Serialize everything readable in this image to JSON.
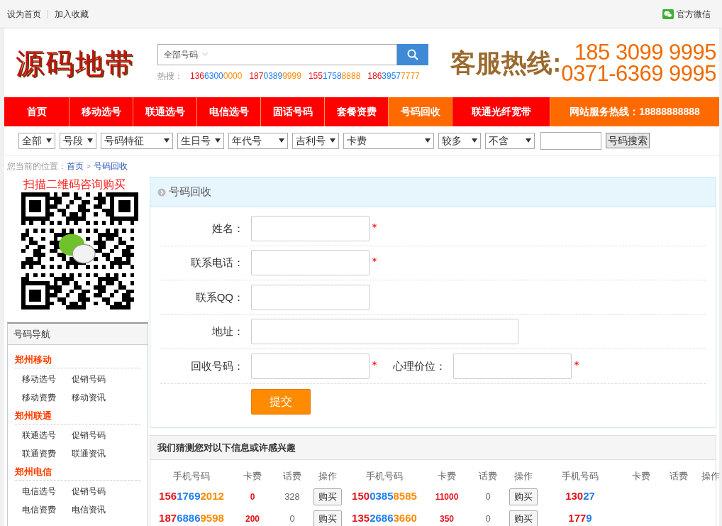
{
  "top_bar": {
    "links": [
      "设为首页",
      "加入收藏"
    ],
    "wechat_label": "官方微信"
  },
  "header": {
    "logo": "源码地带",
    "search": {
      "category": "全部号码",
      "hot_label": "热搜：",
      "hot_numbers": [
        [
          "136",
          "6300",
          "0000"
        ],
        [
          "187",
          "0389",
          "9999"
        ],
        [
          "155",
          "1758",
          "8888"
        ],
        [
          "186",
          "3957",
          "7777"
        ]
      ]
    },
    "hotline": {
      "label": "客服热线:",
      "lines": [
        "185 3099 9995",
        "0371-6369 9995"
      ]
    }
  },
  "nav": {
    "items": [
      {
        "label": "首页",
        "selected": false
      },
      {
        "label": "移动选号",
        "selected": false
      },
      {
        "label": "联通选号",
        "selected": false
      },
      {
        "label": "电信选号",
        "selected": false
      },
      {
        "label": "固话号码",
        "selected": false
      },
      {
        "label": "套餐资费",
        "selected": false
      },
      {
        "label": "号码回收",
        "selected": true
      },
      {
        "label": "联通光纤宽带",
        "selected": false
      }
    ],
    "service_hotline": "网站服务热线：18888888888"
  },
  "filters": {
    "selects": [
      "全部",
      "号段",
      "号码特征",
      "生日号",
      "年代号",
      "吉利号",
      "卡费",
      "较多",
      "不含"
    ],
    "search_button": "号码搜索"
  },
  "breadcrumb": {
    "prefix": "您当前的位置：",
    "links": [
      "首页",
      "号码回收"
    ],
    "separator": ">"
  },
  "sidebar": {
    "qr_caption": "扫描二维码咨询购买",
    "nav_title": "号码导航",
    "groups": [
      {
        "title": "郑州移动",
        "links": [
          "移动选号",
          "促销号码",
          "移动资费",
          "移动资讯"
        ]
      },
      {
        "title": "郑州联通",
        "links": [
          "联通选号",
          "促销号码",
          "联通资费",
          "联通资讯"
        ]
      },
      {
        "title": "郑州电信",
        "links": [
          "电信选号",
          "促销号码",
          "电信资费",
          "电信资讯"
        ]
      }
    ]
  },
  "form": {
    "title": "号码回收",
    "rows": [
      [
        {
          "label": "姓名：",
          "kind": "text",
          "required": true
        }
      ],
      [
        {
          "label": "联系电话：",
          "kind": "text",
          "required": true
        }
      ],
      [
        {
          "label": "联系QQ：",
          "kind": "text",
          "required": false
        }
      ],
      [
        {
          "label": "地址：",
          "kind": "wide",
          "required": false
        }
      ],
      [
        {
          "label": "回收号码：",
          "kind": "text",
          "required": true
        },
        {
          "label": "心理价位：",
          "kind": "text",
          "required": true
        }
      ]
    ],
    "submit": "提交"
  },
  "recommend": {
    "title": "我们猜测您对以下信息或许感兴趣",
    "columns": [
      "手机号码",
      "卡费",
      "话费",
      "操作",
      "手机号码",
      "卡费",
      "话费",
      "操作",
      "手机号码",
      "卡费",
      "话费",
      "操作"
    ],
    "rows": [
      [
        {
          "kind": "number",
          "parts": [
            "156",
            "1769",
            "2012"
          ]
        },
        {
          "kind": "fee",
          "text": "0"
        },
        {
          "kind": "talk",
          "text": "328"
        },
        {
          "kind": "action",
          "text": "购买"
        },
        {
          "kind": "number",
          "parts": [
            "150",
            "0385",
            "8585"
          ]
        },
        {
          "kind": "fee",
          "text": "11000"
        },
        {
          "kind": "talk",
          "text": "0"
        },
        {
          "kind": "action",
          "text": "购买"
        },
        {
          "kind": "number",
          "parts": [
            "130",
            "27"
          ]
        }
      ],
      [
        {
          "kind": "number",
          "parts": [
            "187",
            "6886",
            "9598"
          ]
        },
        {
          "kind": "fee",
          "text": "200"
        },
        {
          "kind": "talk",
          "text": "0"
        },
        {
          "kind": "action",
          "text": "购买"
        },
        {
          "kind": "number",
          "parts": [
            "135",
            "2686",
            "3660"
          ]
        },
        {
          "kind": "fee",
          "text": "350"
        },
        {
          "kind": "talk",
          "text": "0"
        },
        {
          "kind": "action",
          "text": "购买"
        },
        {
          "kind": "number",
          "parts": [
            "177",
            "9"
          ]
        }
      ]
    ]
  }
}
